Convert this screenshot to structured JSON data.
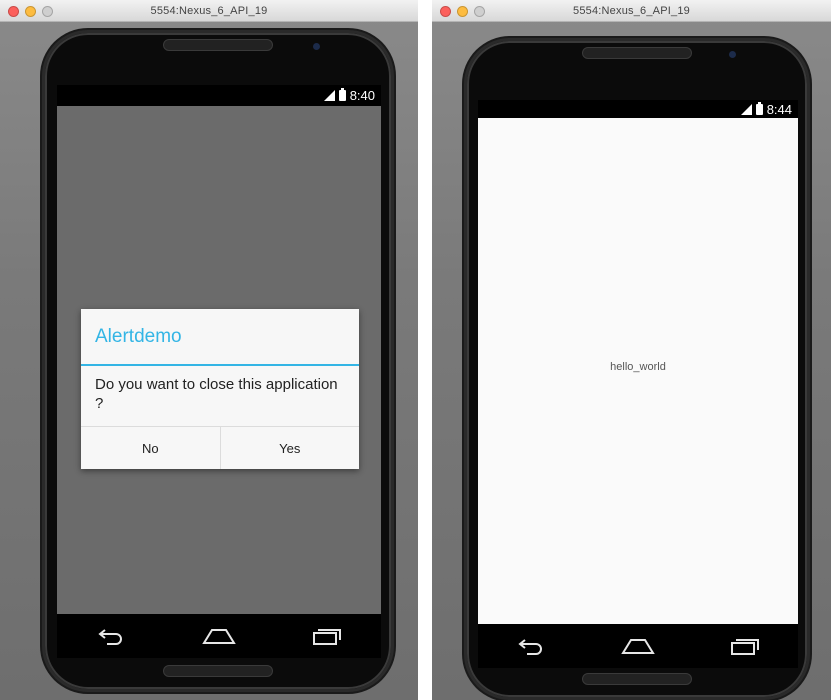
{
  "left_window": {
    "title": "5554:Nexus_6_API_19",
    "status_time": "8:40",
    "dialog": {
      "title": "Alertdemo",
      "message": "Do you want to close this application ?",
      "negative_label": "No",
      "positive_label": "Yes"
    }
  },
  "right_window": {
    "title": "5554:Nexus_6_API_19",
    "status_time": "8:44",
    "content_text": "hello_world"
  },
  "icons": {
    "window_controls": [
      "close-light",
      "minimize-light",
      "zoom-light"
    ],
    "status": [
      "signal-icon",
      "battery-icon"
    ],
    "nav": [
      "back-icon",
      "home-icon",
      "recents-icon"
    ]
  },
  "colors": {
    "dialog_accent": "#33b5e5",
    "left_screen_dim": "#6b6b6b",
    "right_screen_bg": "#fafafa"
  }
}
